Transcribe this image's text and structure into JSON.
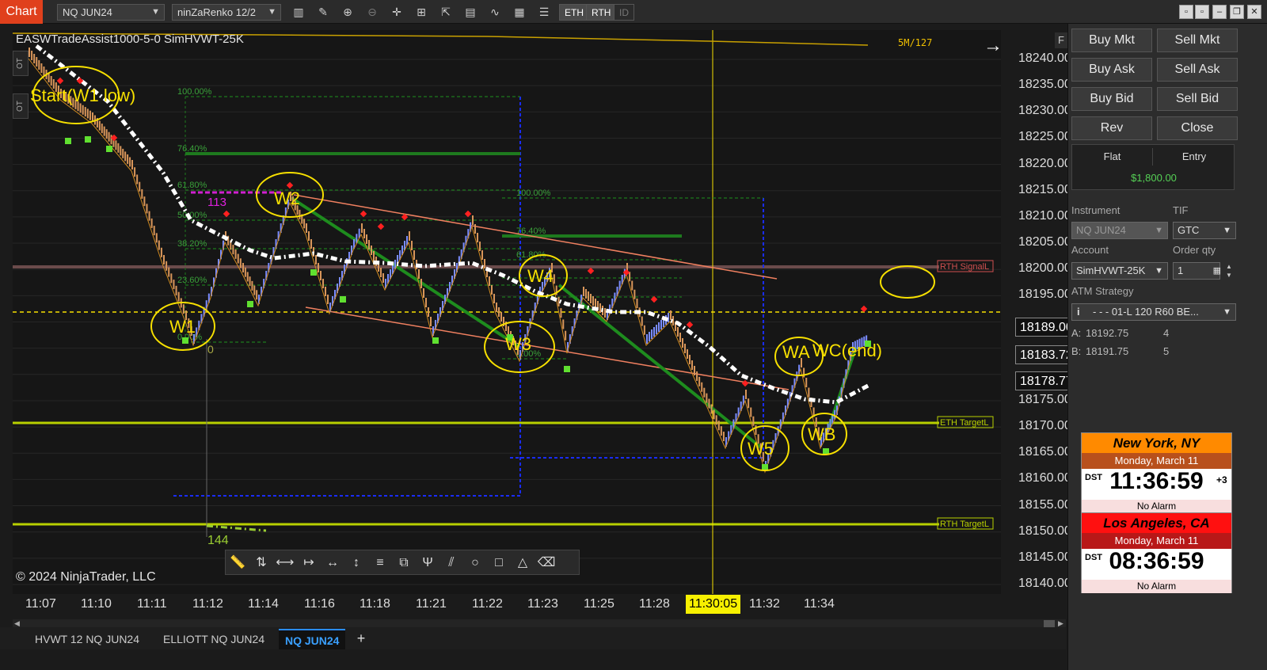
{
  "toolbar": {
    "chart_tab": "Chart",
    "instrument": "NQ JUN24",
    "bar_type": "ninZaRenko 12/2",
    "toggles": [
      "ETH",
      "RTH",
      "ID"
    ]
  },
  "chart": {
    "title": "EASWTradeAssist1000-5-0 SimHVWT-25K",
    "copyright": "© 2024 NinjaTrader, LLC",
    "bar_counter": "5M/127",
    "side_labels": [
      "OT",
      "OT"
    ],
    "f_label": "F",
    "price_ticks": [
      "18240.00",
      "18235.00",
      "18230.00",
      "18225.00",
      "18220.00",
      "18215.00",
      "18210.00",
      "18205.00",
      "18200.00",
      "18195.00",
      "18175.00",
      "18170.00",
      "18165.00",
      "18160.00",
      "18155.00",
      "18150.00",
      "18145.00",
      "18140.00"
    ],
    "price_boxes": [
      {
        "label": "18189.00",
        "bg": "#111111",
        "fg": "#ffffff"
      },
      {
        "label": "18183.72",
        "bg": "#1a1a1a",
        "fg": "#ffffff"
      },
      {
        "label": "18178.77",
        "bg": "#111111",
        "fg": "#ffffff"
      }
    ],
    "time_ticks": [
      "11:07",
      "11:10",
      "11:11",
      "11:12",
      "11:14",
      "11:16",
      "11:18",
      "11:21",
      "11:22",
      "11:23",
      "11:25",
      "11:28",
      "11:32",
      "11:34"
    ],
    "time_current": "11:30:05",
    "line_labels": {
      "rth_signal": "RTH SignalL",
      "eth_target": "ETH TargetL",
      "rth_target": "RTH TargetL"
    },
    "wave_labels": [
      "Start(W1 low)",
      "W1",
      "W2",
      "W3",
      "W4",
      "W5",
      "WA",
      "WC(end)",
      "WB"
    ],
    "fib_labels": [
      "100.00%",
      "76.40%",
      "61.80%",
      "50.00%",
      "38.20%",
      "23.60%",
      "0.00%",
      "100.00%",
      "76.40%",
      "61.80%",
      "0.00%"
    ],
    "count_labels": [
      "113",
      "0",
      "144"
    ],
    "colors": {
      "accent": "#e0401c",
      "bull_candle": "#7a8cff",
      "bear_candle": "#d9965a",
      "wave_ellipse": "#f7e000",
      "trend_line": "#1e8c1e",
      "channel_line": "#f08060",
      "box_line": "#1a2cff",
      "target_line": "#b8d000"
    }
  },
  "tabs": [
    {
      "label": "HVWT 12 NQ JUN24"
    },
    {
      "label": "ELLIOTT NQ JUN24"
    },
    {
      "label": "NQ JUN24"
    }
  ],
  "panel": {
    "buttons": [
      "Buy Mkt",
      "Sell Mkt",
      "Buy Ask",
      "Sell Ask",
      "Buy Bid",
      "Sell Bid",
      "Rev",
      "Close"
    ],
    "position_headers": [
      "Flat",
      "Entry"
    ],
    "position_value": "$1,800.00",
    "instrument_label": "Instrument",
    "instrument_value": "NQ JUN24",
    "tif_label": "TIF",
    "tif_value": "GTC",
    "account_label": "Account",
    "account_value": "SimHVWT-25K",
    "qty_label": "Order qty",
    "qty_value": "1",
    "atm_label": "ATM Strategy",
    "atm_value": "- - - 01-L 120 R60 BE...",
    "ask_label": "A:",
    "ask_price": "18192.75",
    "ask_size": "4",
    "bid_label": "B:",
    "bid_price": "18191.75",
    "bid_size": "5"
  },
  "clocks": [
    {
      "city": "New York, NY",
      "date": "Monday, March 11",
      "dst": "DST",
      "time": "11:36:59",
      "offset": "+3",
      "alarm": "No Alarm",
      "city_bg": "#ff8a00",
      "date_bg": "#b8501c"
    },
    {
      "city": "Los Angeles, CA",
      "date": "Monday, March 11",
      "dst": "DST",
      "time": "08:36:59",
      "offset": "",
      "alarm": "No Alarm",
      "city_bg": "#ff1010",
      "date_bg": "#b81818"
    }
  ]
}
